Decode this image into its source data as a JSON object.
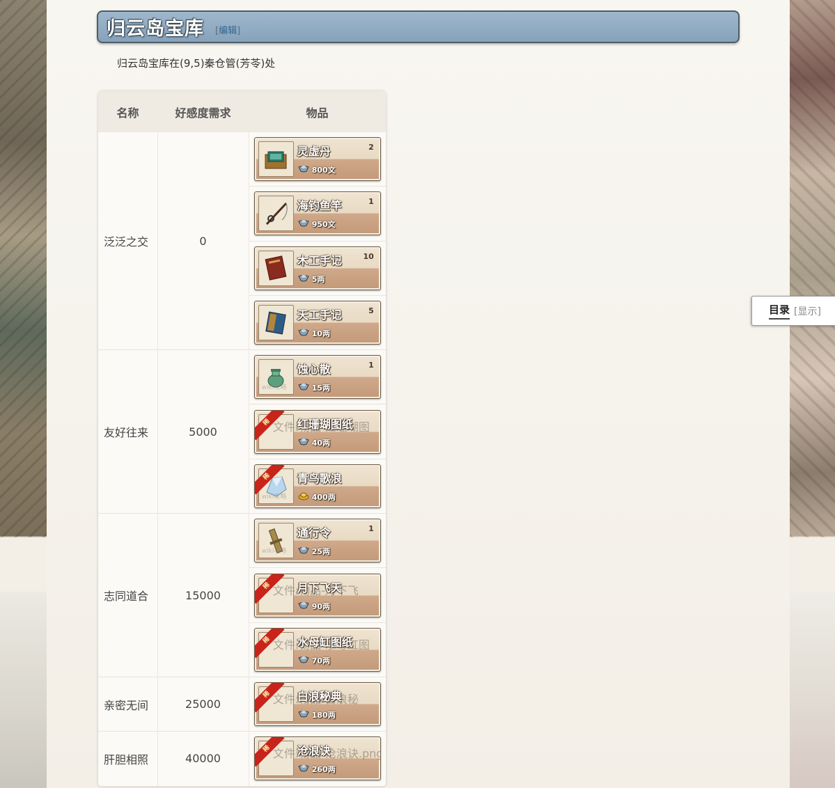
{
  "page": {
    "title": "归云岛宝库",
    "edit_label": "编辑",
    "intro": "归云岛宝库在(9,5)秦仓管(芳苓)处"
  },
  "toc": {
    "title": "目录",
    "toggle": "显示"
  },
  "table": {
    "headers": [
      "名称",
      "好感度需求",
      "物品"
    ],
    "tiers": [
      {
        "name": "泛泛之交",
        "requirement": "0",
        "items": [
          {
            "name": "灵虚丹",
            "count": "2",
            "price": "800文",
            "icon": "book-box-icon"
          },
          {
            "name": "海钓鱼竿",
            "count": "1",
            "price": "950文",
            "icon": "fishing-rod-icon"
          },
          {
            "name": "木工手记",
            "count": "10",
            "price": "5两",
            "icon": "red-book-icon"
          },
          {
            "name": "天工手记",
            "count": "5",
            "price": "10两",
            "icon": "blue-book-icon"
          }
        ]
      },
      {
        "name": "友好往来",
        "requirement": "5000",
        "items": [
          {
            "name": "蚀心散",
            "count": "1",
            "price": "15两",
            "icon": "jar-icon",
            "watermark": "wiki攻略"
          },
          {
            "name": "红珊瑚图纸",
            "count": "",
            "price": "40两",
            "icon": "missing-file-icon",
            "rare": true,
            "placeholder": "文件:物品-红珊瑚图"
          },
          {
            "name": "青鸟歌浪",
            "count": "",
            "price": "400两",
            "icon": "crystal-icon",
            "rare": true,
            "currency": "gold",
            "watermark": "wiki攻略"
          }
        ]
      },
      {
        "name": "志同道合",
        "requirement": "15000",
        "items": [
          {
            "name": "通行令",
            "count": "1",
            "price": "25两",
            "icon": "token-icon",
            "watermark": "wiki攻略"
          },
          {
            "name": "月下飞天",
            "count": "",
            "price": "90两",
            "icon": "missing-file-icon",
            "rare": true,
            "placeholder": "文件:物品-月下飞"
          },
          {
            "name": "水母缸图纸",
            "count": "",
            "price": "70两",
            "icon": "missing-file-icon",
            "rare": true,
            "placeholder": "文件:物品-水母缸图"
          }
        ]
      },
      {
        "name": "亲密无间",
        "requirement": "25000",
        "items": [
          {
            "name": "白浪秘典",
            "count": "",
            "price": "180两",
            "icon": "missing-file-icon",
            "rare": true,
            "placeholder": "文件:物品-白浪秘"
          }
        ]
      },
      {
        "name": "肝胆相照",
        "requirement": "40000",
        "items": [
          {
            "name": "沧浪诀",
            "count": "",
            "price": "260两",
            "icon": "missing-file-icon",
            "rare": true,
            "placeholder": "文件:物品-沧浪诀.png"
          }
        ]
      }
    ]
  },
  "ribbon_label": "稀",
  "colors": {
    "header_bg": "#8fabc4",
    "card_bottom": "#c39a7a",
    "ribbon": "#c8241c",
    "link": "#32668f"
  }
}
